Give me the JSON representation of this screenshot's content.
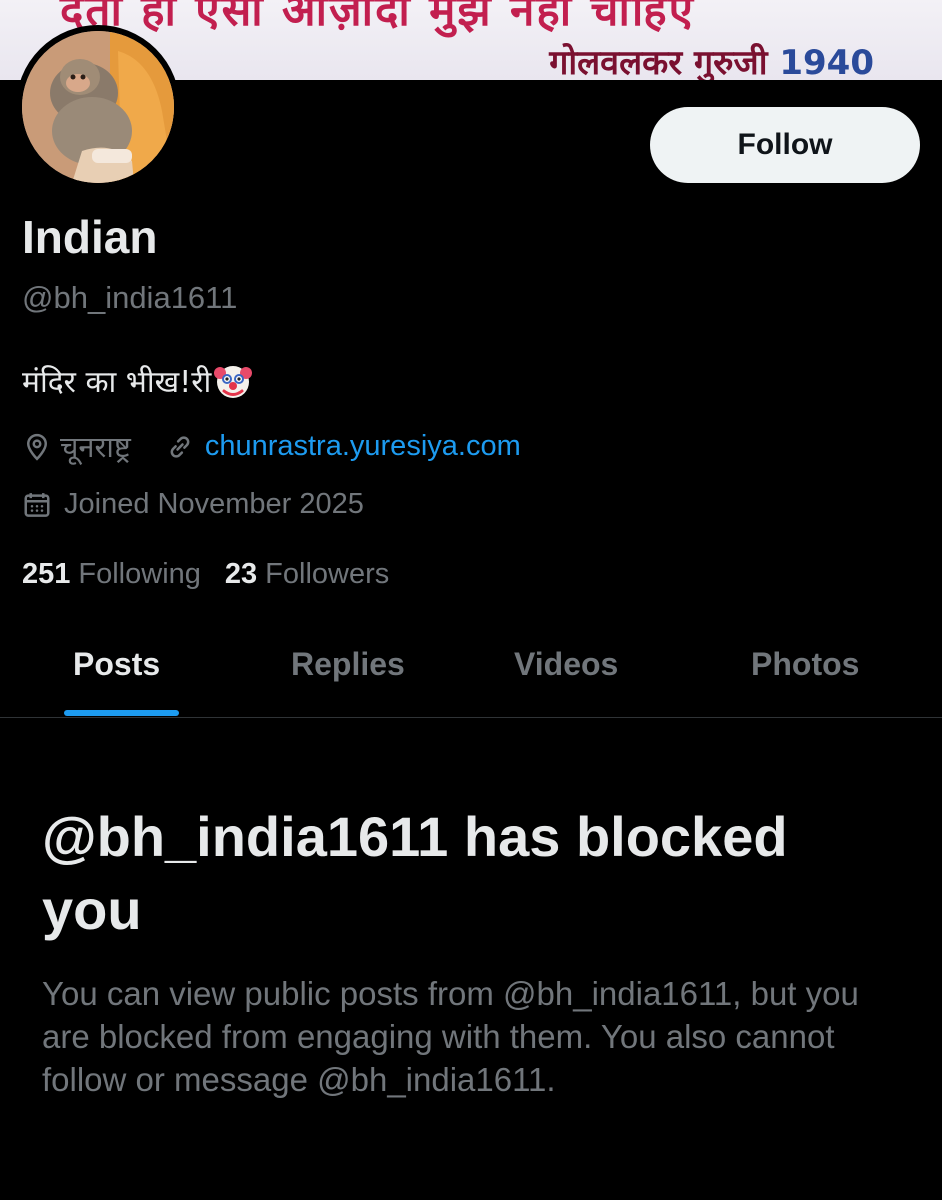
{
  "banner": {
    "line1": "देता हो ऐसी आज़ादी मुझे नहीं चाहिए",
    "line2_text": "गोलवलकर गुरुजी",
    "line2_year": "1940"
  },
  "profile": {
    "display_name": "Indian",
    "handle": "@bh_india1611",
    "bio_text": "मंदिर का भीख!री",
    "location": "चूनराष्ट्र",
    "website": "chunrastra.yuresiya.com",
    "joined": "Joined November 2025"
  },
  "follow_button": {
    "label": "Follow"
  },
  "stats": {
    "following_count": "251",
    "following_label": "Following",
    "followers_count": "23",
    "followers_label": "Followers"
  },
  "tabs": [
    {
      "label": "Posts",
      "active": true
    },
    {
      "label": "Replies",
      "active": false
    },
    {
      "label": "Videos",
      "active": false
    },
    {
      "label": "Photos",
      "active": false
    }
  ],
  "blocked": {
    "title": "@bh_india1611 has blocked you",
    "description": "You can view public posts from @bh_india1611, but you are blocked from engaging with them. You also cannot follow or message @bh_india1611."
  },
  "colors": {
    "background": "#000000",
    "primary_text": "#e7e9ea",
    "secondary_text": "#71767b",
    "accent": "#1d9bf0",
    "button_bg": "#eff3f4"
  },
  "icons": [
    "location-pin-icon",
    "link-icon",
    "calendar-icon",
    "clown-emoji-icon"
  ]
}
